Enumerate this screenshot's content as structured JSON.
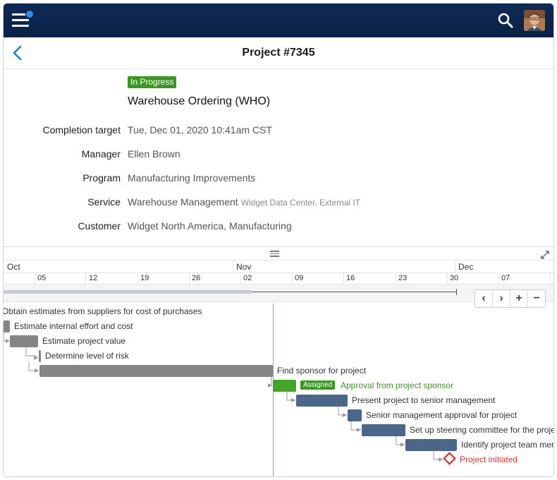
{
  "header": {
    "title": "Project #7345"
  },
  "project": {
    "status": "In Progress",
    "name": "Warehouse Ordering (WHO)",
    "fields": [
      {
        "label": "Completion target",
        "value": "Tue, Dec 01, 2020 10:41am CST",
        "sub": ""
      },
      {
        "label": "Manager",
        "value": "Ellen Brown",
        "sub": ""
      },
      {
        "label": "Program",
        "value": "Manufacturing Improvements",
        "sub": ""
      },
      {
        "label": "Service",
        "value": "Warehouse Management",
        "sub": "Widget Data Center, External IT"
      },
      {
        "label": "Customer",
        "value": "Widget North America, Manufacturing",
        "sub": ""
      }
    ]
  },
  "gantt": {
    "months": [
      "Oct",
      "Nov",
      "Dec"
    ],
    "days": [
      "05",
      "12",
      "19",
      "26",
      "02",
      "09",
      "16",
      "23",
      "30",
      "07"
    ],
    "controls": {
      "prev": "‹",
      "next": "›",
      "zoom_in": "+",
      "zoom_out": "−"
    },
    "tasks": [
      {
        "name": "Obtain estimates from suppliers for cost of purchases",
        "type": "label"
      },
      {
        "name": "Estimate internal effort and cost",
        "type": "gray"
      },
      {
        "name": "Estimate project value",
        "type": "gray"
      },
      {
        "name": "Determine level of risk",
        "type": "gray"
      },
      {
        "name": "Find sponsor for project",
        "type": "gray"
      },
      {
        "name": "Approval from project sponsor",
        "type": "green",
        "badge": "Assigned"
      },
      {
        "name": "Present project to senior management",
        "type": "blue"
      },
      {
        "name": "Senior management approval for project",
        "type": "blue"
      },
      {
        "name": "Set up steering committee for the project",
        "type": "blue"
      },
      {
        "name": "Identify project team members",
        "type": "blue"
      },
      {
        "name": "Project initiated",
        "type": "milestone"
      }
    ]
  },
  "colors": {
    "topbar": "#0a2146",
    "status_green": "#3a9a1f",
    "task_blue": "#4a6688",
    "task_gray": "#858585",
    "milestone_red": "#d0342c"
  }
}
